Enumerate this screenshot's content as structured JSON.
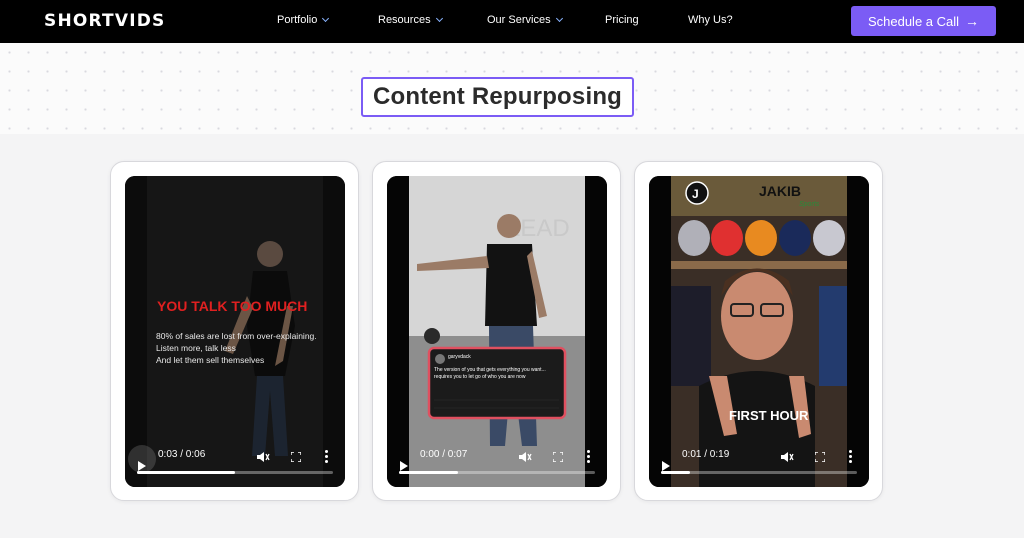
{
  "brand": {
    "logo": "SHORTVIDS",
    "accent": "#7b5cf5"
  },
  "nav": {
    "items": [
      {
        "label": "Portfolio",
        "dropdown": true
      },
      {
        "label": "Resources",
        "dropdown": true
      },
      {
        "label": "Our Services",
        "dropdown": true
      },
      {
        "label": "Pricing",
        "dropdown": false
      },
      {
        "label": "Why Us?",
        "dropdown": false
      }
    ],
    "cta": "Schedule a Call"
  },
  "section": {
    "title": "Content Repurposing"
  },
  "videos": [
    {
      "time": "0:03 / 0:06",
      "progress": 0.5,
      "headline": "YOU TALK TOO MUCH",
      "caption_lines": [
        "80% of sales are lost from over-explaining.",
        "Listen more, talk less",
        "And let them sell themselves"
      ]
    },
    {
      "time": "0:00 / 0:07",
      "progress": 0.3,
      "tweet_user": "garyvdack",
      "tweet_text": "The version of you that gets everything you want... requires you to let go of who you are now"
    },
    {
      "time": "0:01 / 0:19",
      "progress": 0.15,
      "channel": "JAKIB",
      "channel_sub": "Sports",
      "caption": "FIRST HOUR"
    }
  ]
}
